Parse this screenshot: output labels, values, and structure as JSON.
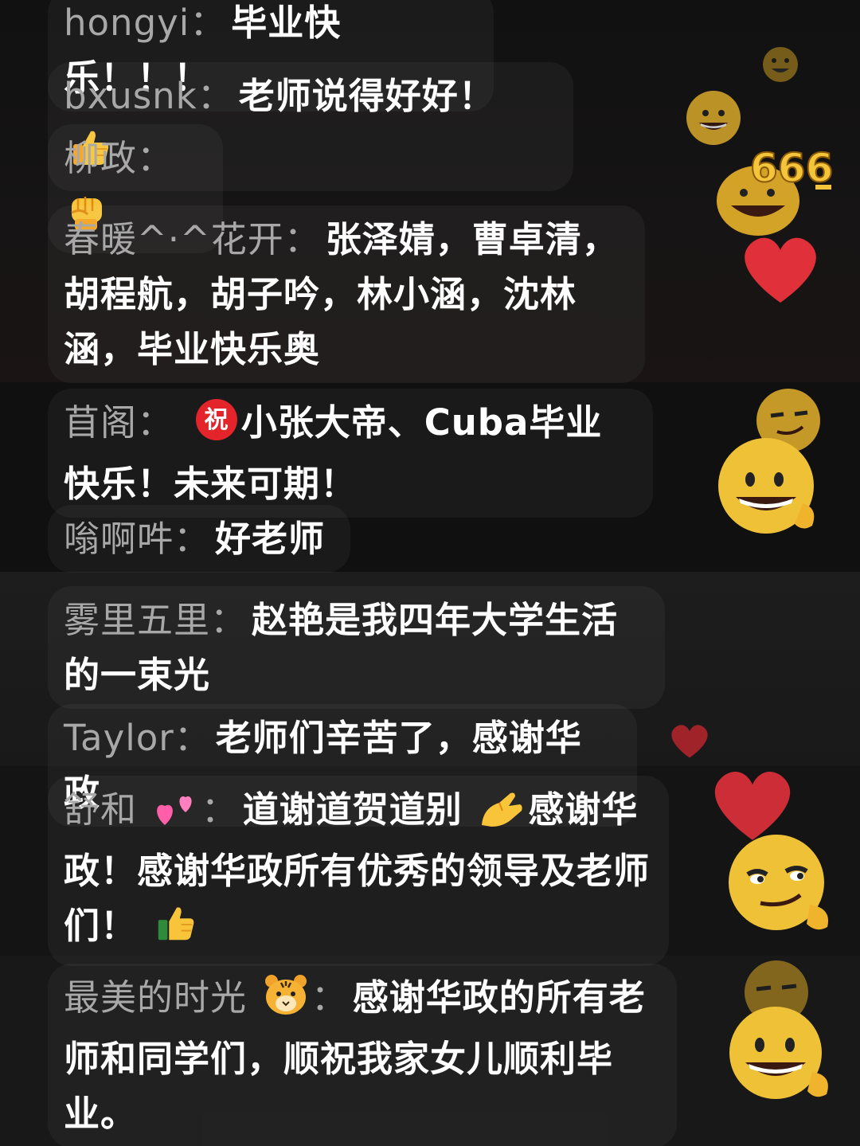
{
  "comments": [
    {
      "user": "hongyi",
      "sep": "：",
      "text": "毕业快乐！！！"
    },
    {
      "user": "bxusnk",
      "sep": "：",
      "text": "老师说得好好！",
      "trail_emoji": "thumbs-up-icon"
    },
    {
      "user": "柳政",
      "sep": "：",
      "trail_emoji": "raised-fist-icon"
    },
    {
      "user": "春暖^·^花开",
      "sep": "：",
      "text": "张泽婧，曹卓清，胡程航，胡子吟，林小涵，沈林涵，毕业快乐奥"
    },
    {
      "user": "苜阁",
      "sep": "：",
      "lead_emoji": "祝",
      "text": "小张大帝、Cuba毕业快乐！未来可期！"
    },
    {
      "user": "嗡啊吽",
      "sep": "：",
      "text": "好老师"
    },
    {
      "user": "雾里五里",
      "sep": "：",
      "text": "赵艳是我四年大学生活的一束光"
    },
    {
      "user": "Taylor",
      "sep": "：",
      "text": "老师们辛苦了，感谢华政"
    },
    {
      "user": "舒和",
      "sep": "：",
      "user_emoji": "two-hearts-icon",
      "text_a": "道谢道贺道别",
      "mid_emoji": "pinching-hand-icon",
      "text_b": "感谢华政！感谢华政所有优秀的领导及老师们！",
      "trail_emoji": "thumbs-up-icon"
    },
    {
      "user": "最美的时光",
      "sep": "：",
      "user_emoji": "tiger-face-icon",
      "text": "感谢华政的所有老师和同学们，顺祝我家女儿顺利毕业。"
    }
  ],
  "decor": {
    "floating_reactions": [
      "grin-face-icon",
      "heart-icon",
      "smirk-face-icon",
      "666-badge-icon"
    ],
    "badge_666": "666"
  },
  "colors": {
    "background": "#141414",
    "username": "#a8a8a8",
    "message": "#ffffff",
    "heart": "#e0303a",
    "face": "#f2c230",
    "zhu_badge": "#e3242b"
  }
}
